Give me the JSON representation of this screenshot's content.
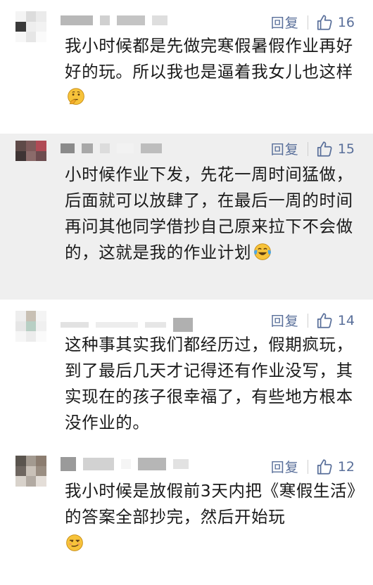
{
  "comments": [
    {
      "reply_label": "回复",
      "likes": "16",
      "text": "我小时候都是先做完寒假暑假作业再好好的玩。所以我也是逼着我女儿也这样",
      "emoji": "thinking-face-emoji",
      "highlighted": false
    },
    {
      "reply_label": "回复",
      "likes": "15",
      "text": "小时候作业下发，先花一周时间猛做，后面就可以放肆了，在最后一周的时间再问其他同学借抄自己原来拉下不会做的，这就是我的作业计划",
      "emoji": "tears-of-joy-emoji",
      "highlighted": true
    },
    {
      "reply_label": "回复",
      "likes": "14",
      "text": "这种事其实我们都经历过，假期疯玩，到了最后几天才记得还有作业没写，其实现在的孩子很幸福了，有些地方根本没作业的。",
      "emoji": "",
      "highlighted": false
    },
    {
      "reply_label": "回复",
      "likes": "12",
      "text": "我小时候是放假前3天内把《寒假生活》的答案全部抄完，然后开始玩",
      "emoji": "smirking-face-emoji",
      "highlighted": false
    }
  ],
  "colors": {
    "link": "#596f9a",
    "highlight_bg": "#efefef",
    "text": "#1a1a1a"
  }
}
